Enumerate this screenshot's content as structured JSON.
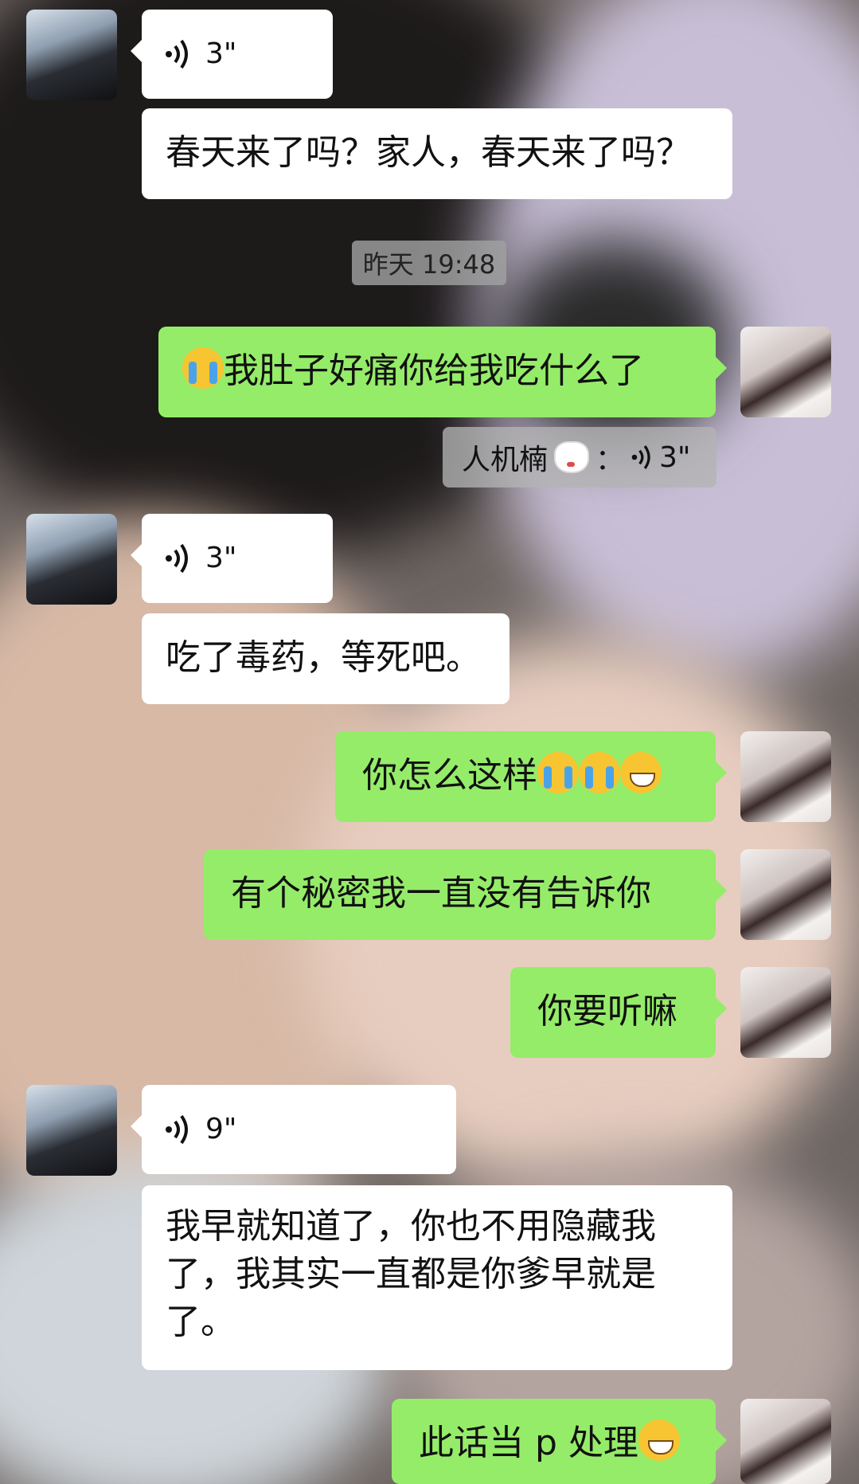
{
  "timestamp": "昨天 19:48",
  "messages": [
    {
      "voice_duration": "3\""
    },
    {
      "text": "春天来了吗？家人，春天来了吗？"
    },
    {
      "text": "我肚子好痛你给我吃什么了"
    },
    {
      "quote_name": "人机楠",
      "quote_sep": "：",
      "quote_voice": "3\""
    },
    {
      "voice_duration": "3\""
    },
    {
      "text": "吃了毒药，等死吧。"
    },
    {
      "text": "你怎么这样"
    },
    {
      "text": "有个秘密我一直没有告诉你"
    },
    {
      "text": "你要听嘛"
    },
    {
      "voice_duration": "9\""
    },
    {
      "text_line1": "我早就知道了，你也不用隐藏我",
      "text_line2": "了，我其实一直都是你爹早就是",
      "text_line3": "了。"
    },
    {
      "text": "此话当 p 处理"
    }
  ],
  "colors": {
    "outgoing": "#95ec69",
    "incoming": "#ffffff"
  },
  "icons": [
    "voice-wave-icon",
    "cry-emoji-icon",
    "grin-emoji-icon",
    "dog-emoji-icon"
  ]
}
